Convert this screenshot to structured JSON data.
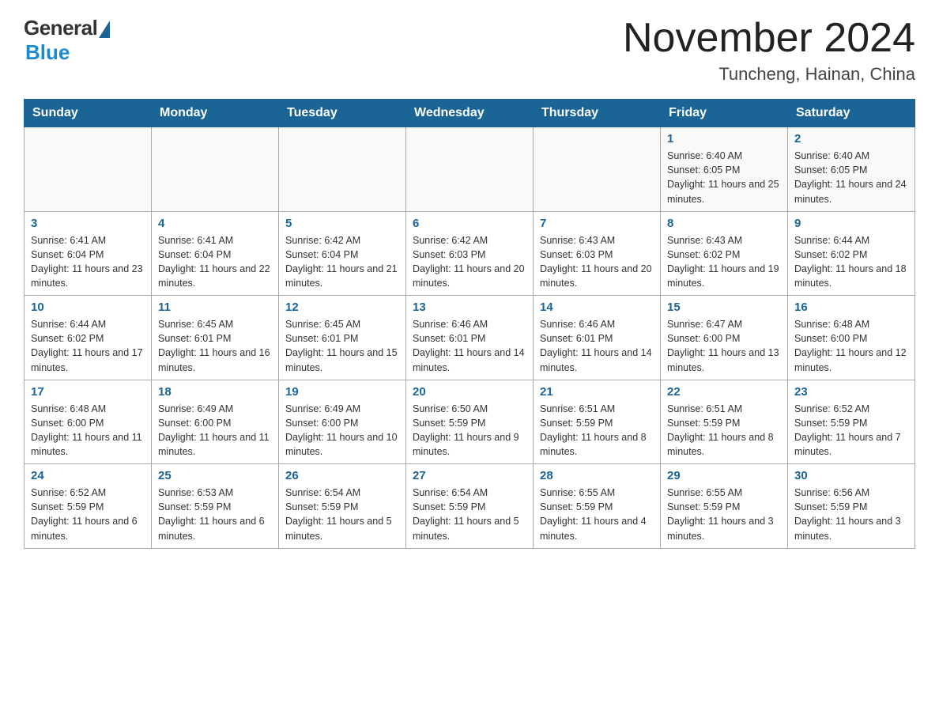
{
  "logo": {
    "general": "General",
    "blue": "Blue"
  },
  "title": {
    "month_year": "November 2024",
    "location": "Tuncheng, Hainan, China"
  },
  "weekdays": [
    "Sunday",
    "Monday",
    "Tuesday",
    "Wednesday",
    "Thursday",
    "Friday",
    "Saturday"
  ],
  "weeks": [
    [
      {
        "day": "",
        "info": ""
      },
      {
        "day": "",
        "info": ""
      },
      {
        "day": "",
        "info": ""
      },
      {
        "day": "",
        "info": ""
      },
      {
        "day": "",
        "info": ""
      },
      {
        "day": "1",
        "info": "Sunrise: 6:40 AM\nSunset: 6:05 PM\nDaylight: 11 hours and 25 minutes."
      },
      {
        "day": "2",
        "info": "Sunrise: 6:40 AM\nSunset: 6:05 PM\nDaylight: 11 hours and 24 minutes."
      }
    ],
    [
      {
        "day": "3",
        "info": "Sunrise: 6:41 AM\nSunset: 6:04 PM\nDaylight: 11 hours and 23 minutes."
      },
      {
        "day": "4",
        "info": "Sunrise: 6:41 AM\nSunset: 6:04 PM\nDaylight: 11 hours and 22 minutes."
      },
      {
        "day": "5",
        "info": "Sunrise: 6:42 AM\nSunset: 6:04 PM\nDaylight: 11 hours and 21 minutes."
      },
      {
        "day": "6",
        "info": "Sunrise: 6:42 AM\nSunset: 6:03 PM\nDaylight: 11 hours and 20 minutes."
      },
      {
        "day": "7",
        "info": "Sunrise: 6:43 AM\nSunset: 6:03 PM\nDaylight: 11 hours and 20 minutes."
      },
      {
        "day": "8",
        "info": "Sunrise: 6:43 AM\nSunset: 6:02 PM\nDaylight: 11 hours and 19 minutes."
      },
      {
        "day": "9",
        "info": "Sunrise: 6:44 AM\nSunset: 6:02 PM\nDaylight: 11 hours and 18 minutes."
      }
    ],
    [
      {
        "day": "10",
        "info": "Sunrise: 6:44 AM\nSunset: 6:02 PM\nDaylight: 11 hours and 17 minutes."
      },
      {
        "day": "11",
        "info": "Sunrise: 6:45 AM\nSunset: 6:01 PM\nDaylight: 11 hours and 16 minutes."
      },
      {
        "day": "12",
        "info": "Sunrise: 6:45 AM\nSunset: 6:01 PM\nDaylight: 11 hours and 15 minutes."
      },
      {
        "day": "13",
        "info": "Sunrise: 6:46 AM\nSunset: 6:01 PM\nDaylight: 11 hours and 14 minutes."
      },
      {
        "day": "14",
        "info": "Sunrise: 6:46 AM\nSunset: 6:01 PM\nDaylight: 11 hours and 14 minutes."
      },
      {
        "day": "15",
        "info": "Sunrise: 6:47 AM\nSunset: 6:00 PM\nDaylight: 11 hours and 13 minutes."
      },
      {
        "day": "16",
        "info": "Sunrise: 6:48 AM\nSunset: 6:00 PM\nDaylight: 11 hours and 12 minutes."
      }
    ],
    [
      {
        "day": "17",
        "info": "Sunrise: 6:48 AM\nSunset: 6:00 PM\nDaylight: 11 hours and 11 minutes."
      },
      {
        "day": "18",
        "info": "Sunrise: 6:49 AM\nSunset: 6:00 PM\nDaylight: 11 hours and 11 minutes."
      },
      {
        "day": "19",
        "info": "Sunrise: 6:49 AM\nSunset: 6:00 PM\nDaylight: 11 hours and 10 minutes."
      },
      {
        "day": "20",
        "info": "Sunrise: 6:50 AM\nSunset: 5:59 PM\nDaylight: 11 hours and 9 minutes."
      },
      {
        "day": "21",
        "info": "Sunrise: 6:51 AM\nSunset: 5:59 PM\nDaylight: 11 hours and 8 minutes."
      },
      {
        "day": "22",
        "info": "Sunrise: 6:51 AM\nSunset: 5:59 PM\nDaylight: 11 hours and 8 minutes."
      },
      {
        "day": "23",
        "info": "Sunrise: 6:52 AM\nSunset: 5:59 PM\nDaylight: 11 hours and 7 minutes."
      }
    ],
    [
      {
        "day": "24",
        "info": "Sunrise: 6:52 AM\nSunset: 5:59 PM\nDaylight: 11 hours and 6 minutes."
      },
      {
        "day": "25",
        "info": "Sunrise: 6:53 AM\nSunset: 5:59 PM\nDaylight: 11 hours and 6 minutes."
      },
      {
        "day": "26",
        "info": "Sunrise: 6:54 AM\nSunset: 5:59 PM\nDaylight: 11 hours and 5 minutes."
      },
      {
        "day": "27",
        "info": "Sunrise: 6:54 AM\nSunset: 5:59 PM\nDaylight: 11 hours and 5 minutes."
      },
      {
        "day": "28",
        "info": "Sunrise: 6:55 AM\nSunset: 5:59 PM\nDaylight: 11 hours and 4 minutes."
      },
      {
        "day": "29",
        "info": "Sunrise: 6:55 AM\nSunset: 5:59 PM\nDaylight: 11 hours and 3 minutes."
      },
      {
        "day": "30",
        "info": "Sunrise: 6:56 AM\nSunset: 5:59 PM\nDaylight: 11 hours and 3 minutes."
      }
    ]
  ]
}
